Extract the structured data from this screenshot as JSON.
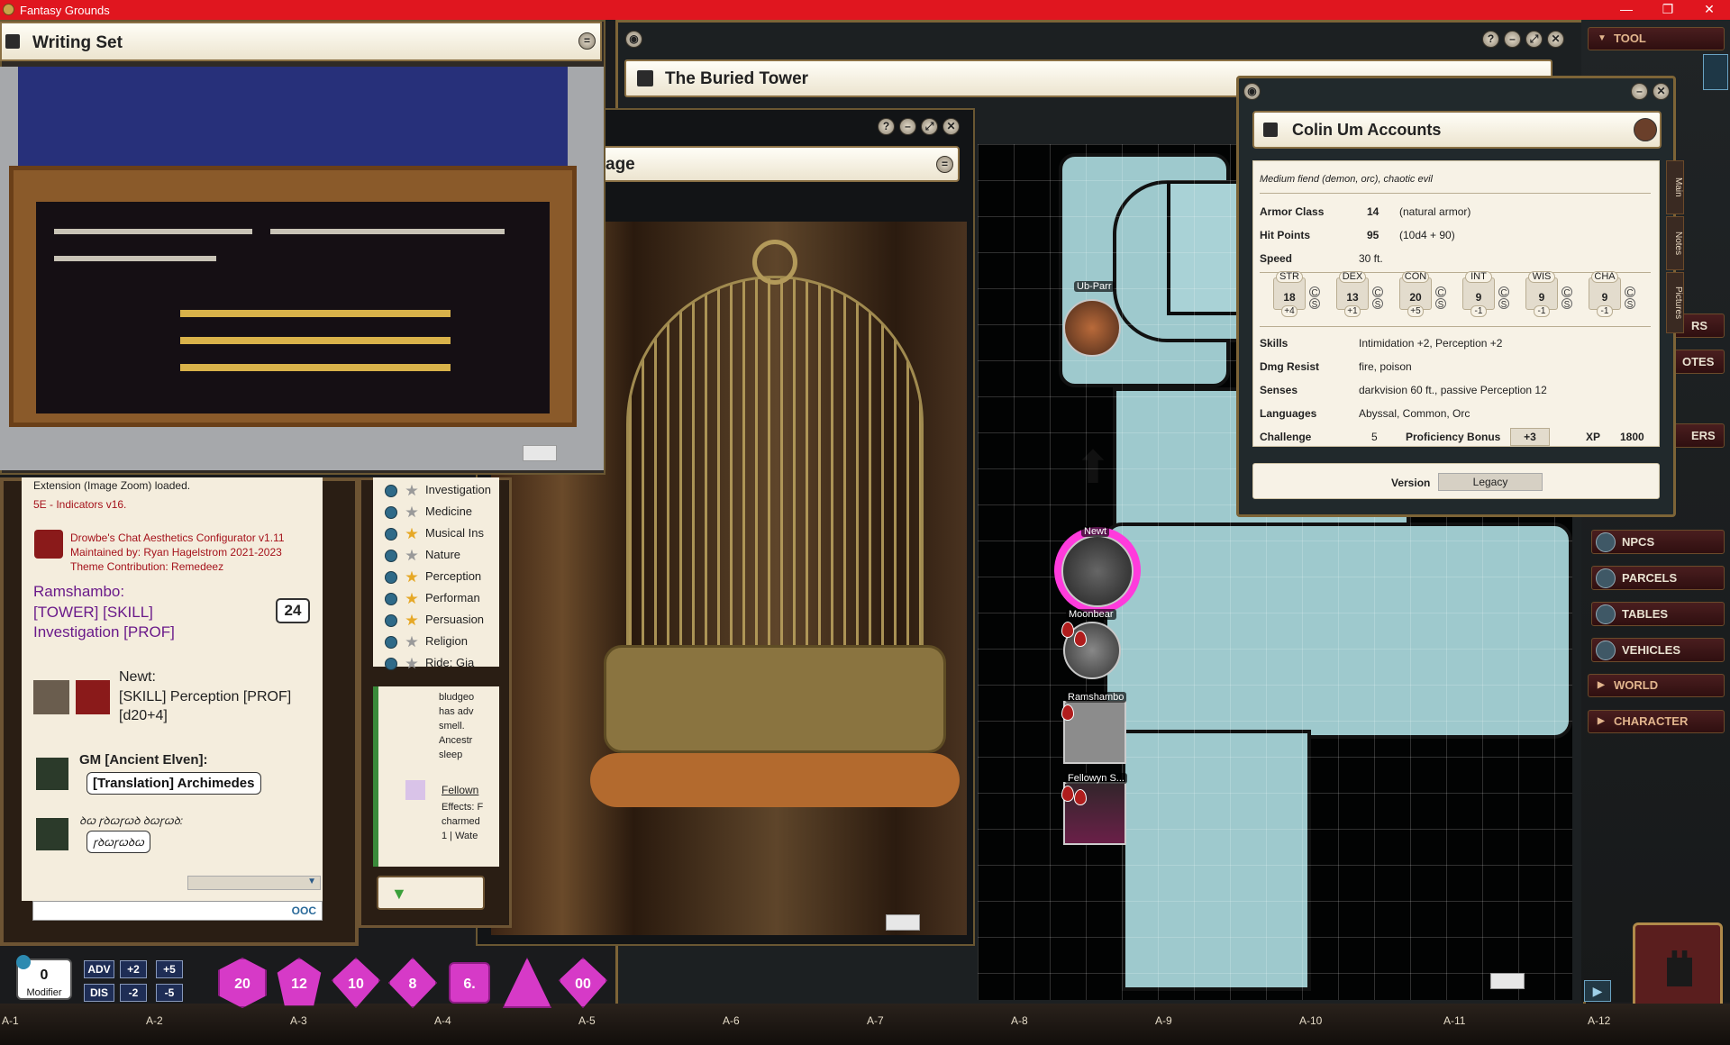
{
  "app": {
    "title": "Fantasy Grounds"
  },
  "writing_set": {
    "title": "Writing Set"
  },
  "buried_tower": {
    "title": "The Buried Tower"
  },
  "image_window": {
    "title_fragment": "age"
  },
  "colin": {
    "title": "Colin Um Accounts",
    "type": "Medium fiend (demon, orc), chaotic evil",
    "armor_class_label": "Armor Class",
    "armor_class": "14",
    "armor_note": "(natural armor)",
    "hp_label": "Hit Points",
    "hp": "95",
    "hp_note": "(10d4 + 90)",
    "speed_label": "Speed",
    "speed": "30 ft.",
    "abilities": [
      {
        "name": "STR",
        "score": "18",
        "mod": "+4"
      },
      {
        "name": "DEX",
        "score": "13",
        "mod": "+1"
      },
      {
        "name": "CON",
        "score": "20",
        "mod": "+5"
      },
      {
        "name": "INT",
        "score": "9",
        "mod": "-1"
      },
      {
        "name": "WIS",
        "score": "9",
        "mod": "-1"
      },
      {
        "name": "CHA",
        "score": "9",
        "mod": "-1"
      }
    ],
    "save_c": "C",
    "save_s": "S",
    "skills_label": "Skills",
    "skills": "Intimidation +2, Perception +2",
    "dmg_resist_label": "Dmg Resist",
    "dmg_resist": "fire, poison",
    "senses_label": "Senses",
    "senses": "darkvision 60 ft., passive Perception 12",
    "languages_label": "Languages",
    "languages": "Abyssal, Common, Orc",
    "challenge_label": "Challenge",
    "challenge": "5",
    "prof_label": "Proficiency Bonus",
    "prof": "+3",
    "xp_label": "XP",
    "xp": "1800",
    "version_label": "Version",
    "version": "Legacy",
    "tabs": [
      "Main",
      "Notes",
      "Pictures"
    ]
  },
  "chat": {
    "line1": "Extension (Image Zoom) loaded.",
    "line2": "5E - Indicators v16.",
    "config1": "Drowbe's Chat Aesthetics Configurator v1.11",
    "config2": "Maintained by: Ryan Hagelstrom 2021-2023",
    "config3": "Theme Contribution: Remedeez",
    "ram_name": "Ramshambo:",
    "ram_roll": "[TOWER] [SKILL] Investigation [PROF]",
    "ram_result": "24",
    "newt_name": "Newt:",
    "newt_roll": "[SKILL] Perception [PROF] [d20+4]",
    "gm_name": "GM [Ancient Elven]:",
    "gm_trans": "[Translation] Archimedes",
    "elven1": "ꝺꞷ ꞅꝺꞷꞅꞷꝺ ꝺꞷꞅꞷꝺ:",
    "elven2": "ꞅꝺꞷꞅꞷꝺꞷ",
    "ooc": "OOC"
  },
  "skills": [
    {
      "name": "Investigation",
      "gold": false
    },
    {
      "name": "Medicine",
      "gold": false
    },
    {
      "name": "Musical Ins",
      "gold": true
    },
    {
      "name": "Nature",
      "gold": false
    },
    {
      "name": "Perception",
      "gold": true
    },
    {
      "name": "Performan",
      "gold": true
    },
    {
      "name": "Persuasion",
      "gold": true
    },
    {
      "name": "Religion",
      "gold": false
    },
    {
      "name": "Ride: Gia",
      "gold": false
    }
  ],
  "effects_text": {
    "l1": "bludgeo",
    "l2": "has adv",
    "l3": "smell.",
    "l4": "Ancestr",
    "l5": "sleep",
    "fellow": "Fellown",
    "e1": "Effects: F",
    "e2": "charmed",
    "e3": "1 | Wate"
  },
  "tokens": {
    "ub": "Ub-Parr",
    "newt": "Newt",
    "moonbear": "Moonbear",
    "ram": "Ramshambo",
    "fellowyn": "Fellowyn S..."
  },
  "sidebar": {
    "tool": "TOOL",
    "partial1": "RS",
    "partial2": "OTES",
    "partial3": "ERS",
    "npcs": "NPCS",
    "parcels": "PARCELS",
    "tables": "TABLES",
    "vehicles": "VEHICLES",
    "world": "WORLD",
    "character": "CHARACTER"
  },
  "modifier": {
    "value": "0",
    "label": "Modifier"
  },
  "modbuttons": {
    "adv": "ADV",
    "dis": "DIS",
    "p2": "+2",
    "m2": "-2",
    "p5": "+5",
    "m5": "-5"
  },
  "dice": [
    "20",
    "12",
    "10",
    "8",
    "6.",
    "",
    "00"
  ],
  "coords": [
    "A-1",
    "A-2",
    "A-3",
    "A-4",
    "A-5",
    "A-6",
    "A-7",
    "A-8",
    "A-9",
    "A-10",
    "A-11",
    "A-12"
  ],
  "window_controls": {
    "minimize": "—",
    "restore": "❐",
    "close": "✕"
  }
}
